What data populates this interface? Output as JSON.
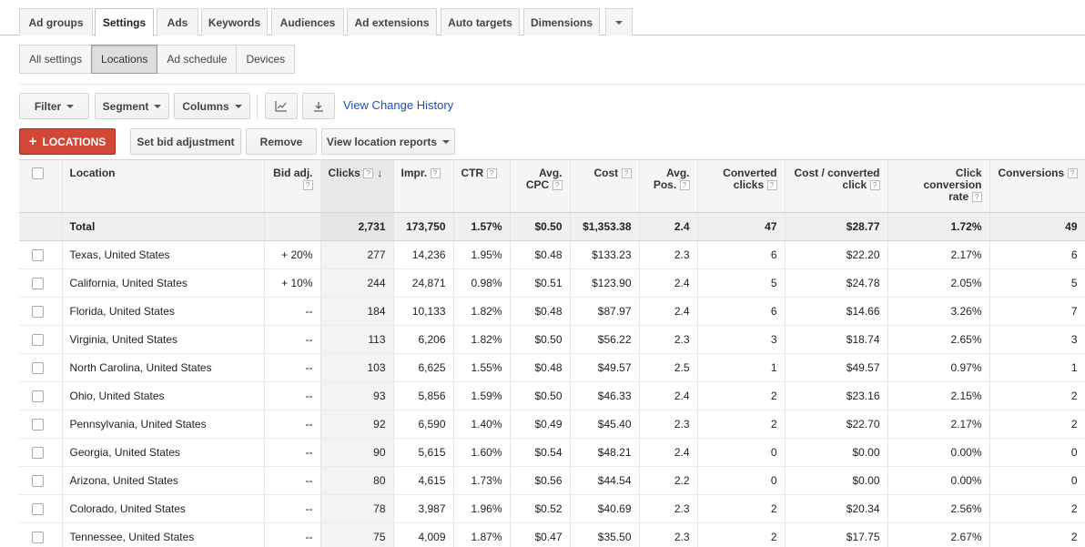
{
  "top_tabs": [
    "Ad groups",
    "Settings",
    "Ads",
    "Keywords",
    "Audiences",
    "Ad extensions",
    "Auto targets",
    "Dimensions"
  ],
  "sub_tabs": [
    "All settings",
    "Locations",
    "Ad schedule",
    "Devices"
  ],
  "toolbar": {
    "filter": "Filter",
    "segment": "Segment",
    "columns": "Columns",
    "view_change_history": "View Change History",
    "add_locations": "LOCATIONS",
    "set_bid": "Set bid adjustment",
    "remove": "Remove",
    "view_location_reports": "View location reports"
  },
  "table": {
    "headers": {
      "location": "Location",
      "bid_adj": "Bid adj.",
      "clicks": "Clicks",
      "impr": "Impr.",
      "ctr": "CTR",
      "avg_cpc_1": "Avg.",
      "avg_cpc_2": "CPC",
      "cost": "Cost",
      "avg_pos_1": "Avg.",
      "avg_pos_2": "Pos.",
      "conv_clicks_1": "Converted",
      "conv_clicks_2": "clicks",
      "cost_conv_1": "Cost / converted",
      "cost_conv_2": "click",
      "click_conv_1": "Click conversion",
      "click_conv_2": "rate",
      "conversions": "Conversions"
    },
    "total": {
      "label": "Total",
      "clicks": "2,731",
      "impr": "173,750",
      "ctr": "1.57%",
      "avg_cpc": "$0.50",
      "cost": "$1,353.38",
      "avg_pos": "2.4",
      "conv_clicks": "47",
      "cost_conv": "$28.77",
      "click_conv": "1.72%",
      "conversions": "49"
    },
    "rows": [
      {
        "location": "Texas, United States",
        "bid": "+ 20%",
        "clicks": "277",
        "impr": "14,236",
        "ctr": "1.95%",
        "cpc": "$0.48",
        "cost": "$133.23",
        "pos": "2.3",
        "cc": "6",
        "cpcc": "$22.20",
        "rate": "2.17%",
        "conv": "6"
      },
      {
        "location": "California, United States",
        "bid": "+ 10%",
        "clicks": "244",
        "impr": "24,871",
        "ctr": "0.98%",
        "cpc": "$0.51",
        "cost": "$123.90",
        "pos": "2.4",
        "cc": "5",
        "cpcc": "$24.78",
        "rate": "2.05%",
        "conv": "5"
      },
      {
        "location": "Florida, United States",
        "bid": "--",
        "clicks": "184",
        "impr": "10,133",
        "ctr": "1.82%",
        "cpc": "$0.48",
        "cost": "$87.97",
        "pos": "2.4",
        "cc": "6",
        "cpcc": "$14.66",
        "rate": "3.26%",
        "conv": "7"
      },
      {
        "location": "Virginia, United States",
        "bid": "--",
        "clicks": "113",
        "impr": "6,206",
        "ctr": "1.82%",
        "cpc": "$0.50",
        "cost": "$56.22",
        "pos": "2.3",
        "cc": "3",
        "cpcc": "$18.74",
        "rate": "2.65%",
        "conv": "3"
      },
      {
        "location": "North Carolina, United States",
        "bid": "--",
        "clicks": "103",
        "impr": "6,625",
        "ctr": "1.55%",
        "cpc": "$0.48",
        "cost": "$49.57",
        "pos": "2.5",
        "cc": "1",
        "cpcc": "$49.57",
        "rate": "0.97%",
        "conv": "1"
      },
      {
        "location": "Ohio, United States",
        "bid": "--",
        "clicks": "93",
        "impr": "5,856",
        "ctr": "1.59%",
        "cpc": "$0.50",
        "cost": "$46.33",
        "pos": "2.4",
        "cc": "2",
        "cpcc": "$23.16",
        "rate": "2.15%",
        "conv": "2"
      },
      {
        "location": "Pennsylvania, United States",
        "bid": "--",
        "clicks": "92",
        "impr": "6,590",
        "ctr": "1.40%",
        "cpc": "$0.49",
        "cost": "$45.40",
        "pos": "2.3",
        "cc": "2",
        "cpcc": "$22.70",
        "rate": "2.17%",
        "conv": "2"
      },
      {
        "location": "Georgia, United States",
        "bid": "--",
        "clicks": "90",
        "impr": "5,615",
        "ctr": "1.60%",
        "cpc": "$0.54",
        "cost": "$48.21",
        "pos": "2.4",
        "cc": "0",
        "cpcc": "$0.00",
        "rate": "0.00%",
        "conv": "0"
      },
      {
        "location": "Arizona, United States",
        "bid": "--",
        "clicks": "80",
        "impr": "4,615",
        "ctr": "1.73%",
        "cpc": "$0.56",
        "cost": "$44.54",
        "pos": "2.2",
        "cc": "0",
        "cpcc": "$0.00",
        "rate": "0.00%",
        "conv": "0"
      },
      {
        "location": "Colorado, United States",
        "bid": "--",
        "clicks": "78",
        "impr": "3,987",
        "ctr": "1.96%",
        "cpc": "$0.52",
        "cost": "$40.69",
        "pos": "2.3",
        "cc": "2",
        "cpcc": "$20.34",
        "rate": "2.56%",
        "conv": "2"
      },
      {
        "location": "Tennessee, United States",
        "bid": "--",
        "clicks": "75",
        "impr": "4,009",
        "ctr": "1.87%",
        "cpc": "$0.47",
        "cost": "$35.50",
        "pos": "2.3",
        "cc": "2",
        "cpcc": "$17.75",
        "rate": "2.67%",
        "conv": "2"
      }
    ]
  },
  "colors": {
    "accent_red": "#d14836",
    "link_blue": "#1a4fb4"
  }
}
